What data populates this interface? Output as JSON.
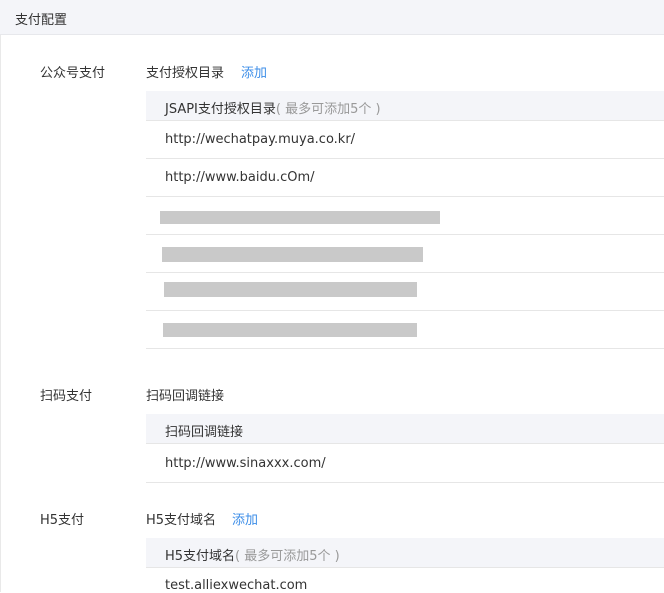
{
  "header": {
    "title": "支付配置"
  },
  "sections": [
    {
      "label": "公众号支付",
      "sub_title": "支付授权目录",
      "add_label": "添加",
      "table_header": "JSAPI支付授权目录",
      "table_hint": "( 最多可添加5个 )",
      "rows": [
        "http://wechatpay.muya.co.kr/",
        "http://www.baidu.cOm/"
      ],
      "redacted_rows": 4
    },
    {
      "label": "扫码支付",
      "sub_title": "扫码回调链接",
      "table_header": "扫码回调链接",
      "rows": [
        "http://www.sinaxxx.com/"
      ]
    },
    {
      "label": "H5支付",
      "sub_title": "H5支付域名",
      "add_label": "添加",
      "table_header": "H5支付域名",
      "table_hint": "( 最多可添加5个 )",
      "rows": [
        "test.alliexwechat.com"
      ]
    }
  ],
  "colors": {
    "link": "#3d8ee8",
    "header_bg": "#f4f5f9",
    "hint": "#999999",
    "redaction": "#c9c9c9"
  }
}
